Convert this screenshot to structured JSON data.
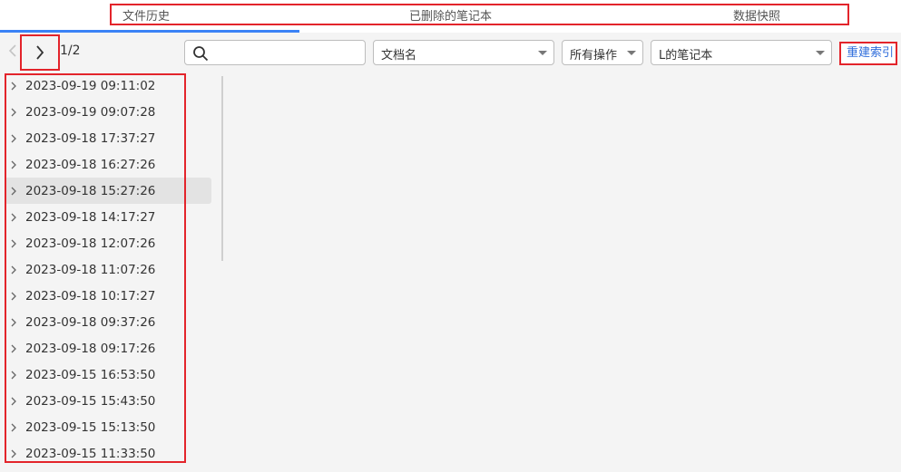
{
  "tabs": [
    {
      "label": "文件历史"
    },
    {
      "label": "已删除的笔记本"
    },
    {
      "label": "数据快照"
    }
  ],
  "pagination": {
    "indicator": "1/2"
  },
  "search": {
    "value": "",
    "placeholder": ""
  },
  "filters": {
    "doc_type": "文档名",
    "operation": "所有操作",
    "notebook": "L的笔记本"
  },
  "rebuild_label": "重建索引",
  "history": [
    {
      "timestamp": "2023-09-19 09:11:02"
    },
    {
      "timestamp": "2023-09-19 09:07:28"
    },
    {
      "timestamp": "2023-09-18 17:37:27"
    },
    {
      "timestamp": "2023-09-18 16:27:26"
    },
    {
      "timestamp": "2023-09-18 15:27:26"
    },
    {
      "timestamp": "2023-09-18 14:17:27"
    },
    {
      "timestamp": "2023-09-18 12:07:26"
    },
    {
      "timestamp": "2023-09-18 11:07:26"
    },
    {
      "timestamp": "2023-09-18 10:17:27"
    },
    {
      "timestamp": "2023-09-18 09:37:26"
    },
    {
      "timestamp": "2023-09-18 09:17:26"
    },
    {
      "timestamp": "2023-09-15 16:53:50"
    },
    {
      "timestamp": "2023-09-15 15:43:50"
    },
    {
      "timestamp": "2023-09-15 15:13:50"
    },
    {
      "timestamp": "2023-09-15 11:33:50"
    }
  ],
  "selected_index": 4,
  "colors": {
    "accent": "#3b82f6",
    "highlight": "#e3242b",
    "link": "#2f6ddb"
  },
  "icons": {
    "prev": "chevron-left-icon",
    "next": "chevron-right-icon",
    "search": "search-icon",
    "expand": "chevron-right-icon"
  }
}
